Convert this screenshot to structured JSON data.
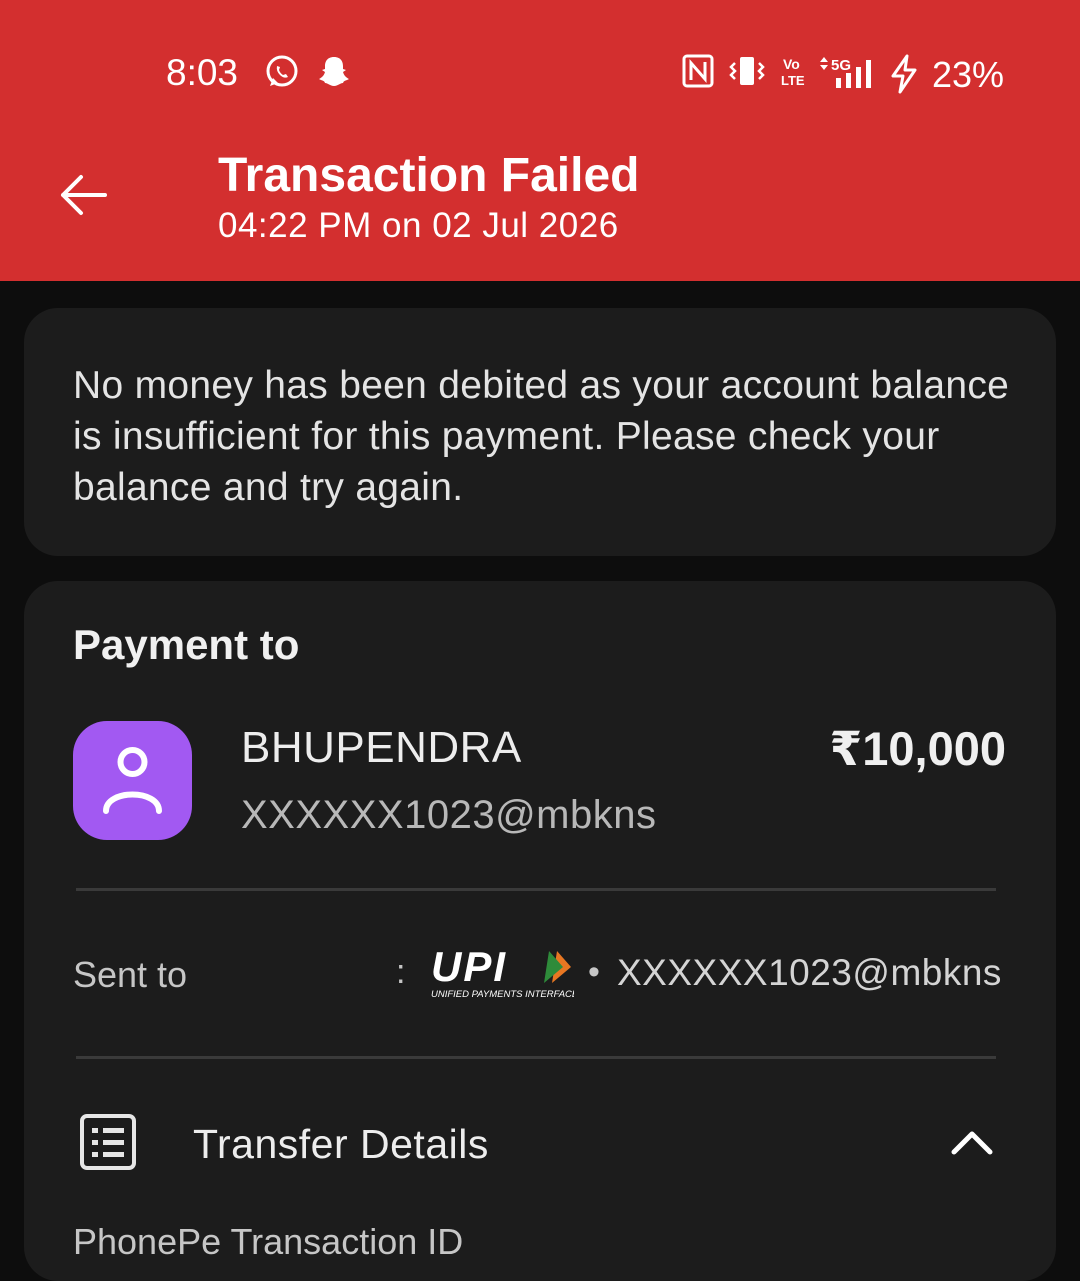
{
  "status_bar": {
    "time": "8:03",
    "battery": "23%",
    "network": "5G",
    "icons": [
      "whatsapp-icon",
      "snapchat-icon",
      "nfc-icon",
      "vibrate-icon",
      "volte-icon",
      "signal-icon",
      "charging-icon"
    ]
  },
  "header": {
    "title": "Transaction Failed",
    "subtitle": "04:22 PM on 02 Jul 2026",
    "background_color": "#d32f2f"
  },
  "notice": {
    "message": "No money has been debited as your account balance is insufficient for this payment. Please check your balance and try again."
  },
  "payment": {
    "heading": "Payment to",
    "payee_name": "BHUPENDRA",
    "payee_upi": "XXXXXX1023@mbkns",
    "amount": "₹10,000",
    "avatar_color": "#a259f2"
  },
  "sent_to": {
    "label": "Sent to",
    "separator": ":",
    "logo_text": "UPI",
    "logo_caption": "UNIFIED PAYMENTS INTERFACE",
    "bullet": "•",
    "upi_id": "XXXXXX1023@mbkns"
  },
  "transfer_details": {
    "label": "Transfer Details",
    "next_label": "PhonePe Transaction ID"
  }
}
